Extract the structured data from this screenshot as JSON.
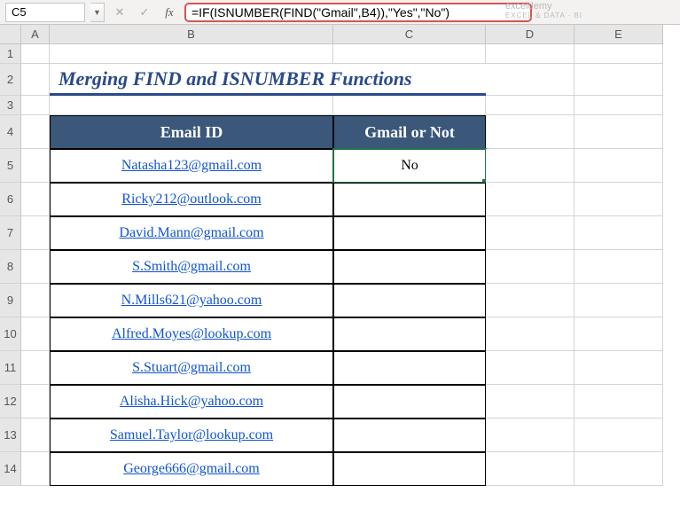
{
  "namebox": "C5",
  "formula": "=IF(ISNUMBER(FIND(\"Gmail\",B4)),\"Yes\",\"No\")",
  "buttons": {
    "cancel": "✕",
    "confirm": "✓",
    "fx": "fx",
    "dropdown": "▼"
  },
  "columns": [
    "A",
    "B",
    "C",
    "D",
    "E"
  ],
  "rows": [
    "1",
    "2",
    "3",
    "4",
    "5",
    "6",
    "7",
    "8",
    "9",
    "10",
    "11",
    "12",
    "13",
    "14"
  ],
  "title": "Merging FIND and ISNUMBER Functions",
  "headers": {
    "b": "Email ID",
    "c": "Gmail or Not"
  },
  "emails": [
    "Natasha123@gmail.com",
    "Ricky212@outlook.com",
    "David.Mann@gmail.com",
    "S.Smith@gmail.com",
    "N.Mills621@yahoo.com",
    "Alfred.Moyes@lookup.com",
    "S.Stuart@gmail.com",
    "Alisha.Hick@yahoo.com",
    "Samuel.Taylor@lookup.com",
    "George666@gmail.com"
  ],
  "results": [
    "No",
    "",
    "",
    "",
    "",
    "",
    "",
    "",
    "",
    ""
  ],
  "watermark": {
    "brand": "exceldemy",
    "tagline": "EXCEL & DATA · BI"
  }
}
